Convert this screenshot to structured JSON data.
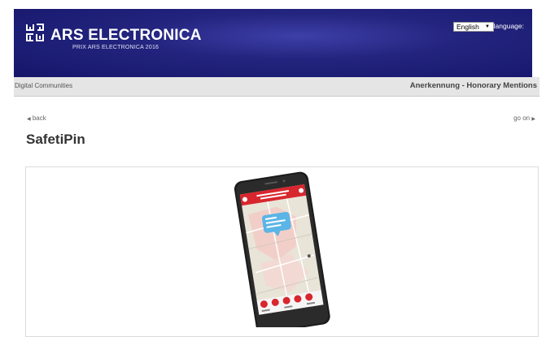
{
  "header": {
    "brand": "ARS ELECTRONICA",
    "subtitle": "PRIX ARS ELECTRONICA 2016",
    "language_label": "Select language:",
    "language_selected": "English",
    "background_color": "#1c1d74"
  },
  "category_bar": {
    "category": "Digital Communities",
    "award": "Anerkennung - Honorary Mentions"
  },
  "nav": {
    "back_label": "back",
    "back_icon": "triangle-left-icon",
    "go_on_label": "go on",
    "go_on_icon": "triangle-right-icon"
  },
  "page": {
    "title": "SafetiPin"
  },
  "image": {
    "content": "smartphone-app-screenshot",
    "app_color": "#d8262e"
  }
}
